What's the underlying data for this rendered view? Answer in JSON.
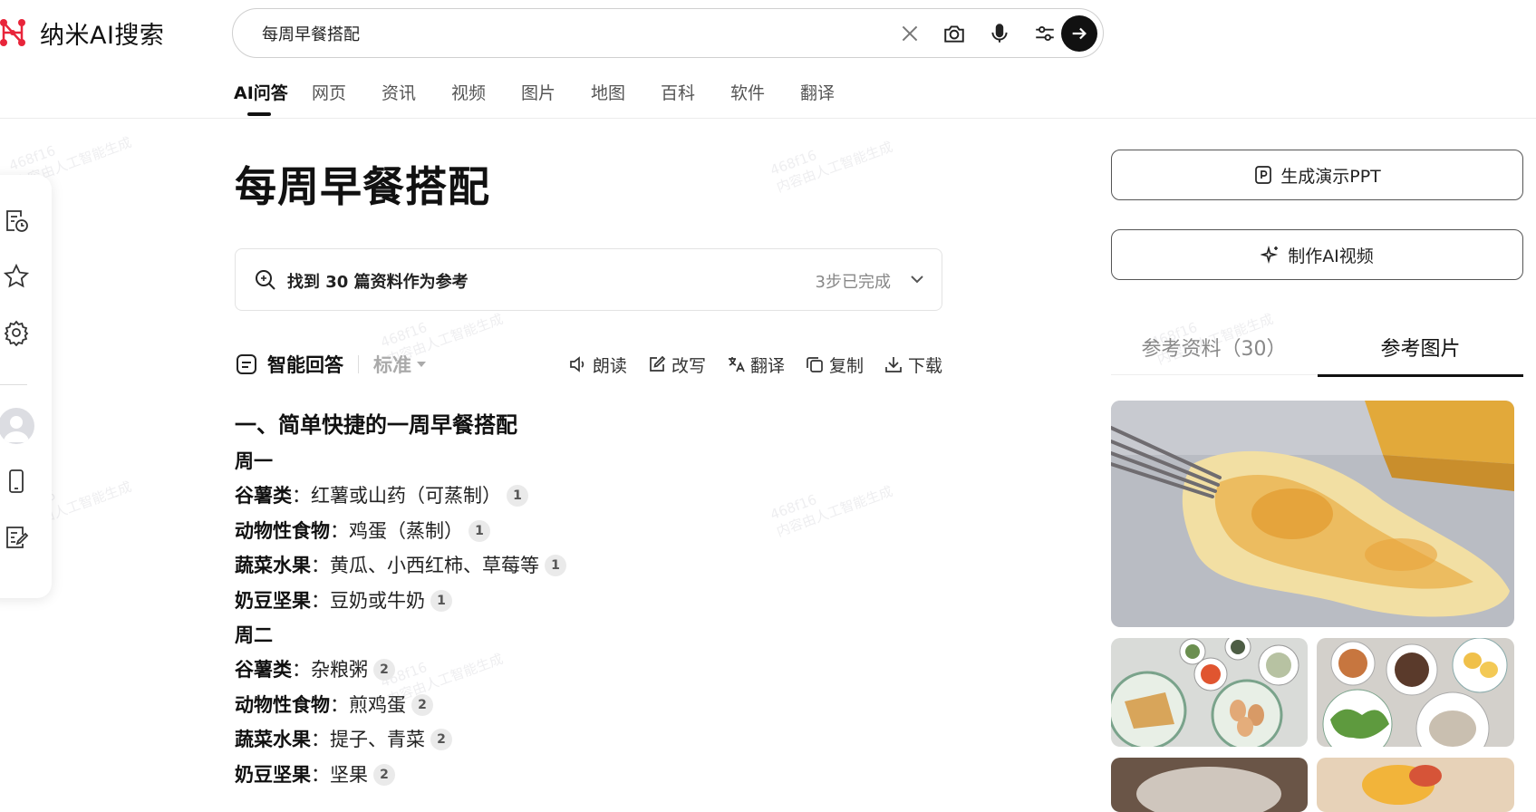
{
  "app": {
    "name": "纳米AI搜索"
  },
  "search": {
    "query": "每周早餐搭配"
  },
  "nav": {
    "tabs": [
      {
        "label": "AI问答",
        "active": true
      },
      {
        "label": "网页"
      },
      {
        "label": "资讯"
      },
      {
        "label": "视频"
      },
      {
        "label": "图片"
      },
      {
        "label": "地图"
      },
      {
        "label": "百科"
      },
      {
        "label": "软件"
      },
      {
        "label": "翻译"
      }
    ]
  },
  "main": {
    "title": "每周早餐搭配",
    "sources": {
      "text": "找到 30 篇资料作为参考",
      "status": "3步已完成"
    },
    "answer_bar": {
      "title": "智能回答",
      "mode": "标准",
      "actions": [
        "朗读",
        "改写",
        "翻译",
        "复制",
        "下载"
      ]
    },
    "section_heading": "一、简单快捷的一周早餐搭配",
    "days": [
      {
        "day": "周一",
        "items": [
          {
            "label": "谷薯类",
            "text": "：红薯或山药（可蒸制）",
            "cite": "1"
          },
          {
            "label": "动物性食物",
            "text": "：鸡蛋（蒸制）",
            "cite": "1"
          },
          {
            "label": "蔬菜水果",
            "text": "：黄瓜、小西红柿、草莓等",
            "cite": "1"
          },
          {
            "label": "奶豆坚果",
            "text": "：豆奶或牛奶",
            "cite": "1"
          }
        ]
      },
      {
        "day": "周二",
        "items": [
          {
            "label": "谷薯类",
            "text": "：杂粮粥",
            "cite": "2"
          },
          {
            "label": "动物性食物",
            "text": "：煎鸡蛋",
            "cite": "2"
          },
          {
            "label": "蔬菜水果",
            "text": "：提子、青菜",
            "cite": "2"
          },
          {
            "label": "奶豆坚果",
            "text": "：坚果",
            "cite": "2"
          }
        ]
      }
    ]
  },
  "right": {
    "ppt_button": "生成演示PPT",
    "video_button": "制作AI视频",
    "tabs": [
      {
        "label": "参考资料（30）",
        "active": false
      },
      {
        "label": "参考图片",
        "active": true
      }
    ]
  },
  "watermark": {
    "line1": "468f16",
    "line2": "内容由人工智能生成"
  },
  "colors": {
    "accent": "#111111",
    "citation_bg": "#eaeaea",
    "muted": "#888888",
    "logo_red": "#e8253a"
  }
}
